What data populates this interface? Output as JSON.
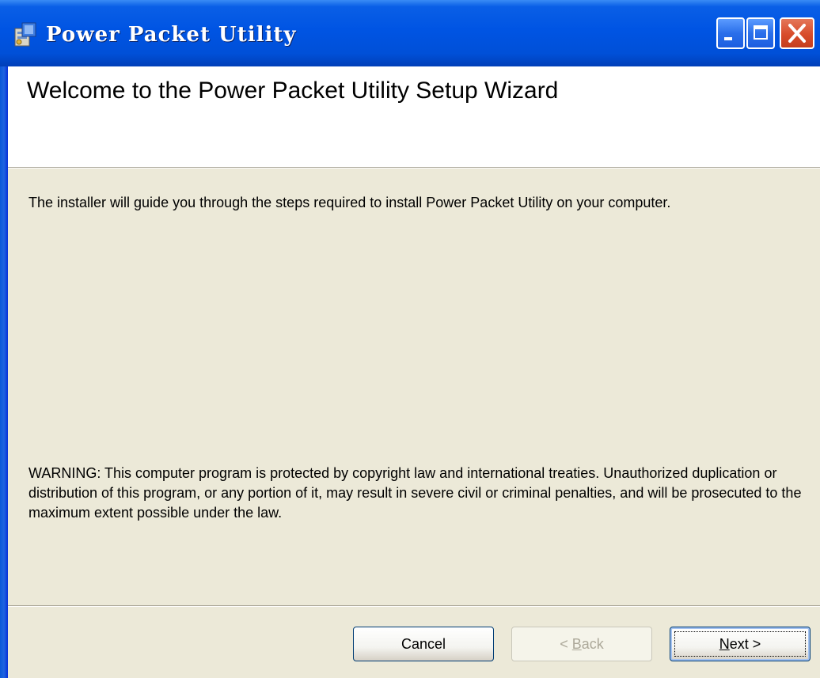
{
  "window": {
    "title": "Power Packet Utility",
    "icon": "installer-icon",
    "controls": [
      "minimize-icon",
      "maximize-icon",
      "close-icon"
    ],
    "colors": {
      "titlebar": "#0054e3",
      "close": "#d84c2a",
      "face": "#ece9d8"
    }
  },
  "banner": {
    "heading": "Welcome to the Power Packet Utility  Setup Wizard"
  },
  "body": {
    "intro": "The installer will guide you through the steps required to install Power Packet Utility  on your computer.",
    "warning": "WARNING: This computer program is protected by copyright law and international treaties. Unauthorized duplication or distribution of this program, or any portion of it, may result in severe civil or criminal penalties, and will be prosecuted to the maximum extent possible under the law."
  },
  "buttons": {
    "cancel": "Cancel",
    "back_prefix": "< ",
    "back_access": "B",
    "back_rest": "ack",
    "next_access": "N",
    "next_rest": "ext >"
  }
}
